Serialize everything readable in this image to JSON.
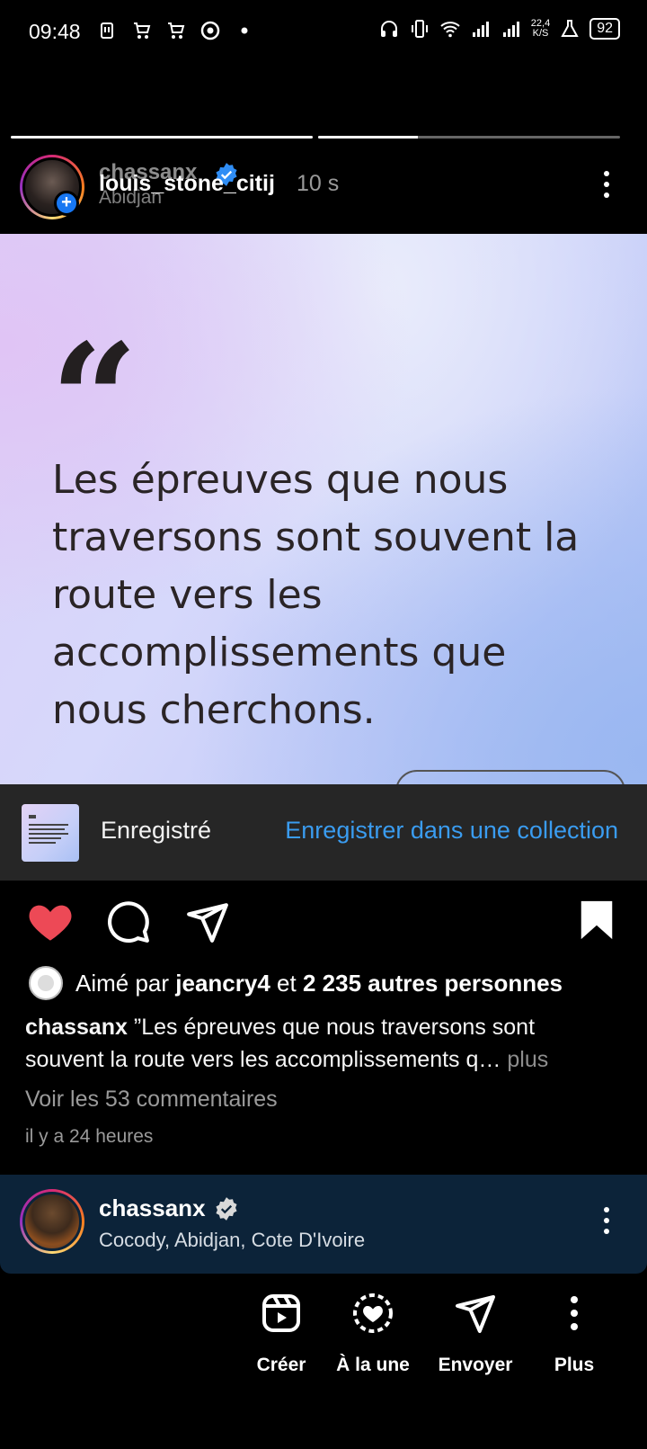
{
  "status_bar": {
    "time": "09:48",
    "network_speed_top": "22,4",
    "network_speed_unit": "K/S",
    "battery": "92"
  },
  "story": {
    "progress": [
      1.0,
      0.33
    ],
    "username_behind": "chassanx",
    "location_behind": "Abidjan",
    "username": "louis_stone_citij",
    "time": "10 s"
  },
  "quote": {
    "mark": "“",
    "text": "Les épreuves que nous traversons sont souvent la route vers les accomplissements que nous cherchons."
  },
  "saved_bar": {
    "label": "Enregistré",
    "link": "Enregistrer dans une collection"
  },
  "actions": {
    "like_icon": "heart-filled-icon",
    "comment_icon": "comment-icon",
    "share_icon": "send-icon",
    "save_icon": "bookmark-filled-icon",
    "like_color": "#ed4956"
  },
  "likes": {
    "prefix": "Aimé par",
    "user": "jeancry4",
    "conj": "et",
    "others": "2 235 autres personnes"
  },
  "caption": {
    "author": "chassanx",
    "text": "”Les épreuves que nous traversons sont souvent la route vers les accomplissements q…",
    "more": "plus"
  },
  "comments_link": "Voir les 53 commentaires",
  "time_ago": "il y a 24 heures",
  "author_bar": {
    "name": "chassanx",
    "location": "Cocody, Abidjan, Cote D'Ivoire"
  },
  "bottom_actions": [
    {
      "label": "Créer",
      "icon": "reels-icon"
    },
    {
      "label": "À la une",
      "icon": "highlight-heart-icon"
    },
    {
      "label": "Envoyer",
      "icon": "send-icon"
    },
    {
      "label": "Plus",
      "icon": "more-vertical-icon"
    }
  ]
}
